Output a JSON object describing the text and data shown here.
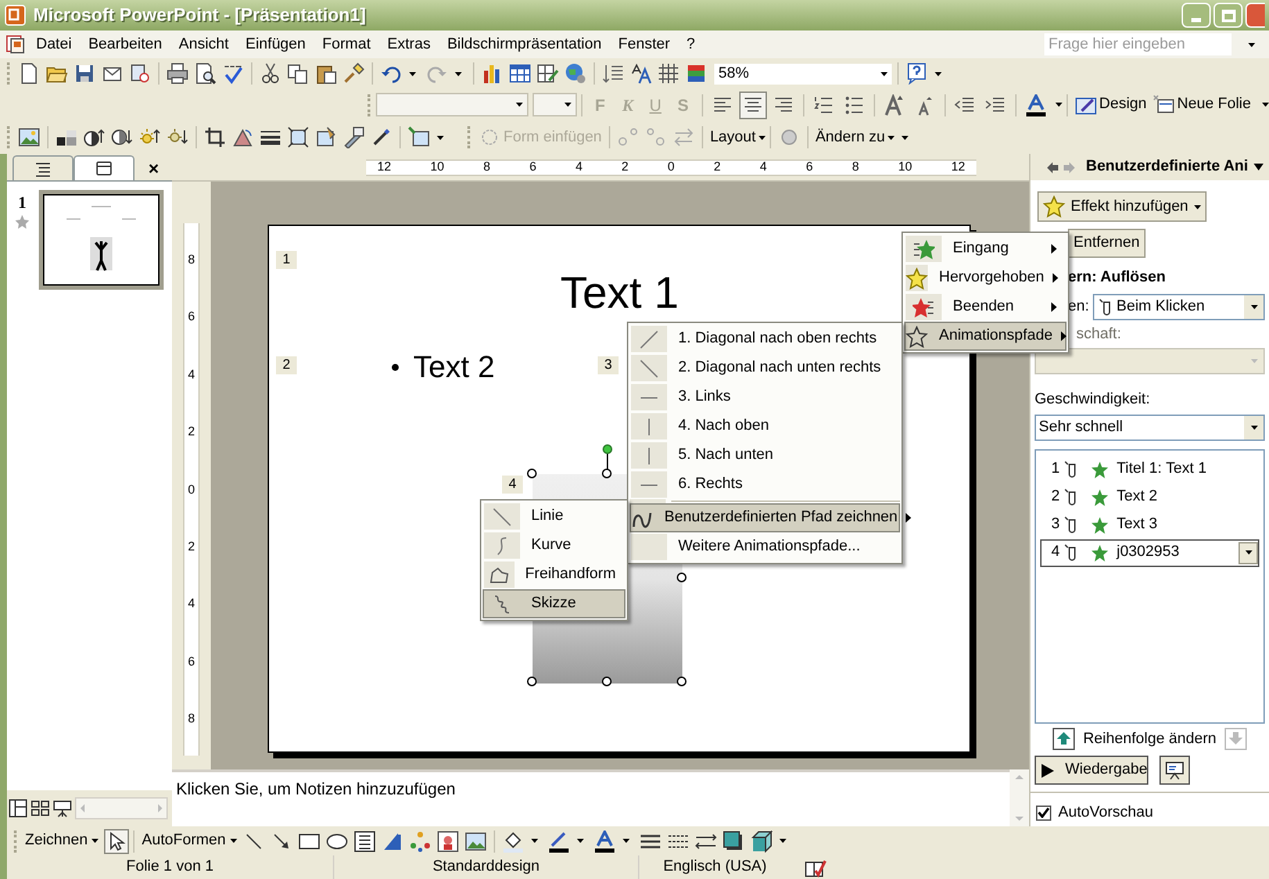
{
  "window": {
    "title": "Microsoft PowerPoint - [Präsentation1]"
  },
  "menu_bar": {
    "items": [
      {
        "label": "Datei"
      },
      {
        "label": "Bearbeiten"
      },
      {
        "label": "Ansicht"
      },
      {
        "label": "Einfügen"
      },
      {
        "label": "Format"
      },
      {
        "label": "Extras"
      },
      {
        "label": "Bildschirmpräsentation"
      },
      {
        "label": "Fenster"
      },
      {
        "label": "?"
      }
    ],
    "help_search": {
      "placeholder": "Frage hier eingeben"
    }
  },
  "standard_toolbar": {
    "zoom": "58%"
  },
  "formatting_toolbar": {
    "styles": [
      "F",
      "K",
      "U",
      "S"
    ],
    "buttons": [
      {
        "label": "Design"
      },
      {
        "label": "Neue Folie"
      }
    ]
  },
  "picture_toolbar": {
    "items": [
      {
        "label": "Form einfügen",
        "disabled": true
      },
      {
        "label": "Layout",
        "disabled": false
      },
      {
        "label": "Ändern zu",
        "disabled": false
      }
    ]
  },
  "left_pane": {
    "tabs": [
      {
        "kind": "outline",
        "selected": false
      },
      {
        "kind": "slides",
        "selected": true
      }
    ],
    "close": "×",
    "slides": [
      {
        "number": "1",
        "selected": true
      }
    ]
  },
  "ruler": {
    "horizontal": [
      "12",
      "10",
      "8",
      "6",
      "4",
      "2",
      "0",
      "2",
      "4",
      "6",
      "8",
      "10",
      "12"
    ],
    "vertical": [
      "8",
      "6",
      "4",
      "2",
      "0",
      "2",
      "4",
      "6",
      "8"
    ]
  },
  "slide": {
    "tags": [
      "1",
      "2",
      "3",
      "4"
    ],
    "title": "Text 1",
    "bullet": "Text 2"
  },
  "effect_menu": {
    "items": [
      {
        "label": "Eingang",
        "kind": "entrance",
        "selected": false
      },
      {
        "label": "Hervorgehoben",
        "kind": "emphasis",
        "selected": false
      },
      {
        "label": "Beenden",
        "kind": "exit",
        "selected": false
      },
      {
        "label": "Animationspfade",
        "kind": "path",
        "selected": true
      }
    ]
  },
  "path_menu": {
    "items": [
      {
        "label": "1. Diagonal nach oben rechts",
        "kind": "diagonal-up",
        "selected": false,
        "submenu": false
      },
      {
        "label": "2. Diagonal nach unten rechts",
        "kind": "diagonal-down",
        "selected": false,
        "submenu": false
      },
      {
        "label": "3. Links",
        "kind": "horizontal",
        "selected": false,
        "submenu": false
      },
      {
        "label": "4. Nach oben",
        "kind": "vertical",
        "selected": false,
        "submenu": false
      },
      {
        "label": "5. Nach unten",
        "kind": "vertical",
        "selected": false,
        "submenu": false
      },
      {
        "label": "6. Rechts",
        "kind": "horizontal",
        "selected": false,
        "submenu": false
      },
      {
        "label": "Benutzerdefinierten Pfad zeichnen",
        "kind": "custom",
        "selected": true,
        "submenu": true
      },
      {
        "label": "Weitere Animationspfade...",
        "kind": "more",
        "selected": false,
        "submenu": false
      }
    ]
  },
  "draw_menu": {
    "items": [
      {
        "label": "Linie",
        "kind": "line",
        "selected": false
      },
      {
        "label": "Kurve",
        "kind": "curve",
        "selected": false
      },
      {
        "label": "Freihandform",
        "kind": "freeform",
        "selected": false
      },
      {
        "label": "Skizze",
        "kind": "scribble",
        "selected": true
      }
    ]
  },
  "task_pane": {
    "title": "Benutzerdefinierte Ani",
    "add_effect": "Effekt hinzufügen",
    "remove": "Entfernen",
    "effect_heading": "ern: Auflösen",
    "start_label": "en:",
    "start_value": "Beim Klicken",
    "property_label": "schaft:",
    "property_disabled": true,
    "speed_label": "Geschwindigkeit:",
    "speed_value": "Sehr schnell",
    "animations": [
      {
        "number": "1",
        "label": "Titel 1: Text 1",
        "selected": false
      },
      {
        "number": "2",
        "label": "Text 2",
        "selected": false
      },
      {
        "number": "3",
        "label": "Text 3",
        "selected": false
      },
      {
        "number": "4",
        "label": "j0302953",
        "selected": true
      }
    ],
    "reorder": "Reihenfolge ändern",
    "play": "Wiedergabe",
    "autopreview": {
      "label": "AutoVorschau",
      "checked": true
    }
  },
  "notes": {
    "placeholder": "Klicken Sie, um Notizen hinzuzufügen"
  },
  "drawing_toolbar": {
    "draw": {
      "label": "Zeichnen"
    },
    "autoshapes": {
      "label": "AutoFormen"
    }
  },
  "status_bar": {
    "slide": "Folie 1 von 1",
    "design": "Standarddesign",
    "language": "Englisch (USA)"
  }
}
